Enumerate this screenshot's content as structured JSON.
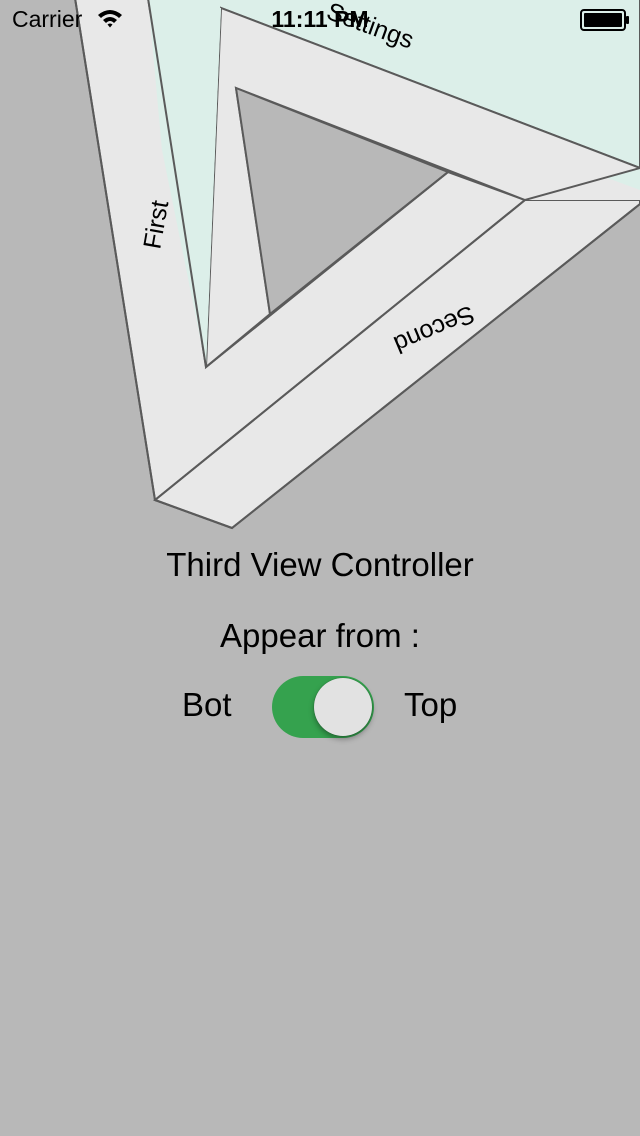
{
  "status_bar": {
    "carrier": "Carrier",
    "time": "11:11 PM",
    "wifi_icon": "wifi-icon",
    "battery_icon": "battery-icon"
  },
  "menu": {
    "items": [
      {
        "label": "First",
        "color": "#e8e8e8"
      },
      {
        "label": "Second",
        "color": "#e8e8e8"
      },
      {
        "label": "Settings",
        "color": "#dcefe9"
      }
    ]
  },
  "main": {
    "title": "Third View Controller",
    "appear_label": "Appear from :",
    "toggle": {
      "left_label": "Bot",
      "right_label": "Top",
      "on": true,
      "on_color": "#35a24e"
    }
  },
  "colors": {
    "background": "#b8b8b8",
    "panel": "#e8e8e8",
    "panel_highlight": "#dcefe9",
    "stroke": "#5a5a5a"
  }
}
